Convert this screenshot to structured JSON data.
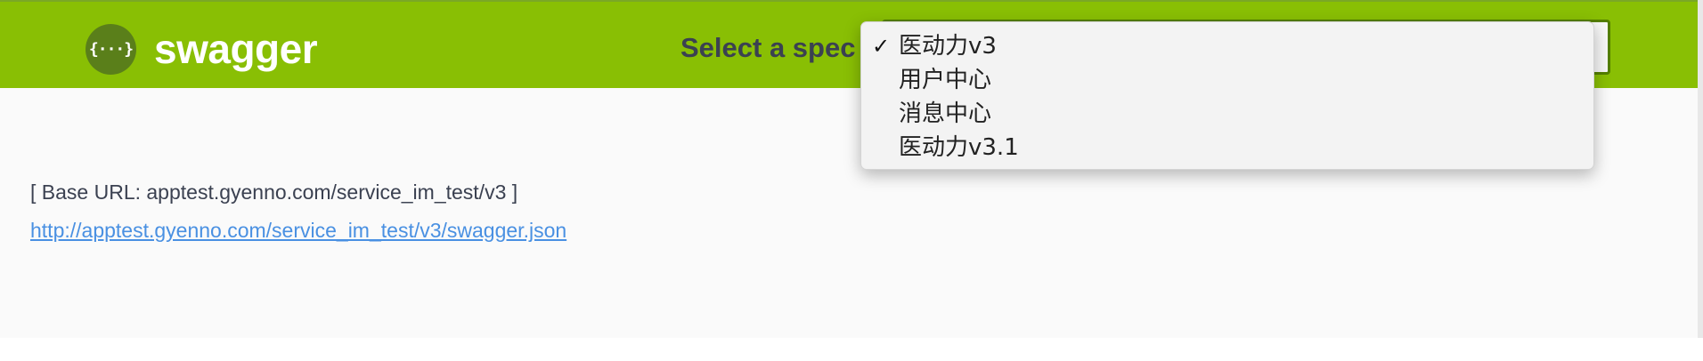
{
  "topbar": {
    "logo_glyph": "{···}",
    "brand_name": "swagger",
    "spec_label": "Select a spec",
    "background_color": "#89bf04"
  },
  "spec_select": {
    "selected": "医动力v3",
    "options": [
      {
        "label": "医动力v3",
        "selected": true
      },
      {
        "label": "用户中心",
        "selected": false
      },
      {
        "label": "消息中心",
        "selected": false
      },
      {
        "label": "医动力v3.1",
        "selected": false
      }
    ],
    "check_glyph": "✓"
  },
  "info": {
    "base_url": "[ Base URL: apptest.gyenno.com/service_im_test/v3 ]",
    "spec_link": "http://apptest.gyenno.com/service_im_test/v3/swagger.json",
    "link_color": "#4990e2"
  }
}
